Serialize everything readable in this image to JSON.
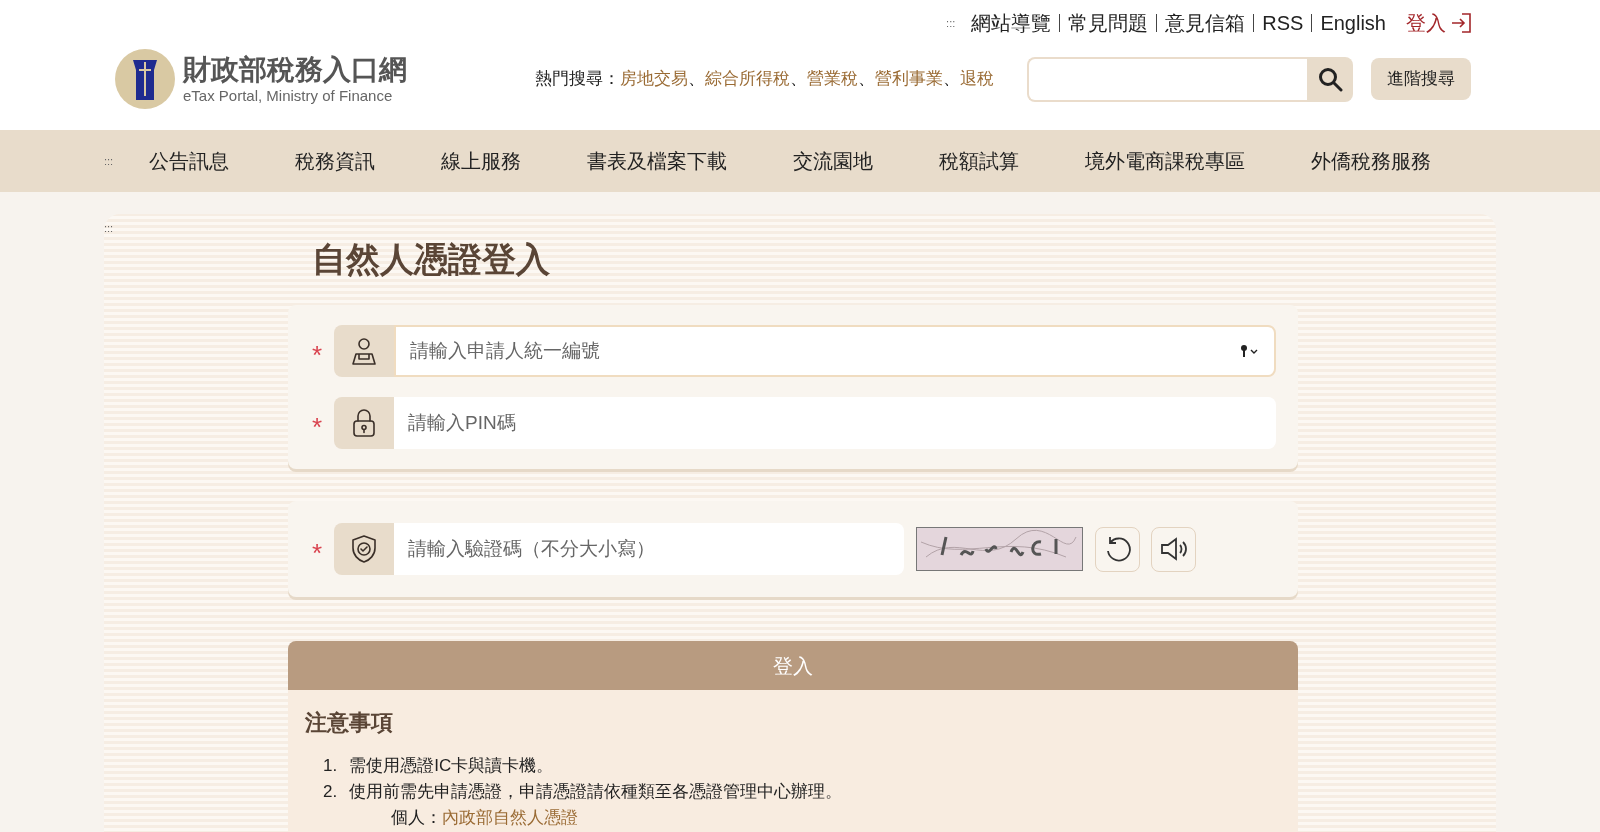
{
  "header": {
    "anchor": ":::",
    "top_links": [
      {
        "label": "網站導覽"
      },
      {
        "label": "常見問題"
      },
      {
        "label": "意見信箱"
      },
      {
        "label": "RSS"
      },
      {
        "label": "English"
      }
    ],
    "login_link": "登入",
    "logo": {
      "title": "財政部稅務入口網",
      "subtitle": "eTax Portal, Ministry of Finance"
    },
    "hot_search": {
      "label": "熱門搜尋：",
      "separator": "、",
      "terms": [
        "房地交易",
        "綜合所得稅",
        "營業稅",
        "營利事業",
        "退稅"
      ]
    },
    "advanced_search": "進階搜尋"
  },
  "nav": {
    "anchor": ":::",
    "items": [
      {
        "label": "公告訊息"
      },
      {
        "label": "稅務資訊"
      },
      {
        "label": "線上服務"
      },
      {
        "label": "書表及檔案下載"
      },
      {
        "label": "交流園地"
      },
      {
        "label": "稅額試算"
      },
      {
        "label": "境外電商課稅專區"
      },
      {
        "label": "外僑稅務服務"
      }
    ]
  },
  "content": {
    "anchor": ":::",
    "title": "自然人憑證登入",
    "required_mark": "*",
    "fields": [
      {
        "kind": "id",
        "placeholder": "請輸入申請人統一編號",
        "focused": true
      },
      {
        "kind": "pin",
        "placeholder": "請輸入PIN碼",
        "focused": false
      }
    ],
    "captcha": {
      "placeholder": "請輸入驗證碼（不分大小寫）"
    },
    "submit": "登入",
    "notice": {
      "title": "注意事項",
      "items": [
        {
          "number": "1.",
          "text": "需使用憑證IC卡與讀卡機。"
        },
        {
          "number": "2.",
          "text": "使用前需先申請憑證，申請憑證請依種類至各憑證管理中心辦理。"
        }
      ],
      "sub_label": "個人：",
      "sub_link": "內政部自然人憑證"
    }
  }
}
